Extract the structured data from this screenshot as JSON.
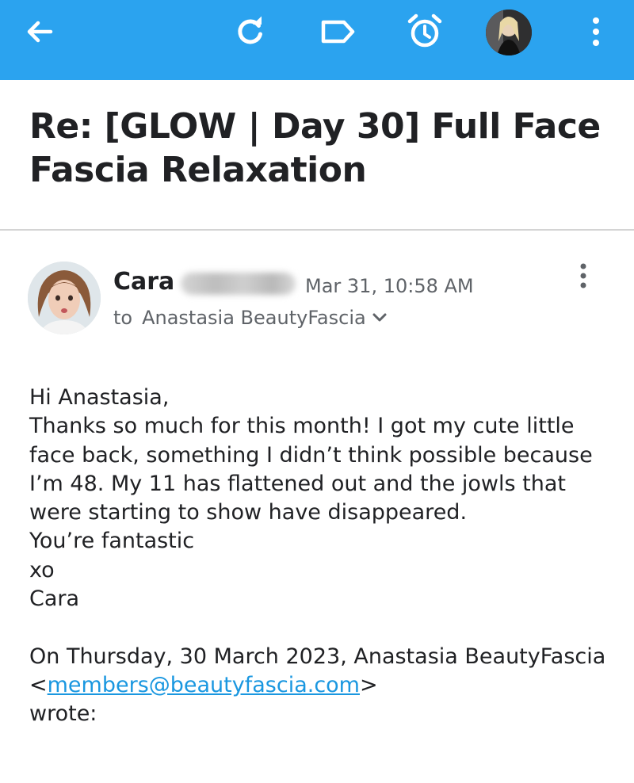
{
  "toolbar": {
    "back_icon": "back-arrow-icon",
    "refresh_icon": "refresh-icon",
    "label_icon": "label-icon",
    "snooze_icon": "alarm-clock-icon",
    "more_icon": "more-vertical-icon",
    "account_avatar": "account-avatar",
    "bar_color": "#2ba3ef"
  },
  "email": {
    "subject": "Re: [GLOW | Day 30] Full Face Fascia Relaxation",
    "sender_name": "Cara",
    "timestamp": "Mar 31, 10:58 AM",
    "recipient_prefix": "to",
    "recipient_name": "Anastasia BeautyFascia",
    "body_lines": [
      "Hi Anastasia,",
      "Thanks so much for this month! I got my cute little face back, something I didn’t think possible because I’m 48. My 11 has flattened out and the jowls that were starting to show have disappeared.",
      "You’re fantastic",
      "xo",
      "Cara"
    ],
    "quote_prefix": "On Thursday, 30 March 2023, Anastasia BeautyFascia <",
    "quote_email": "members@beautyfascia.com",
    "quote_suffix": ">",
    "quote_wrote": "wrote:",
    "link_color": "#1a97e0"
  }
}
